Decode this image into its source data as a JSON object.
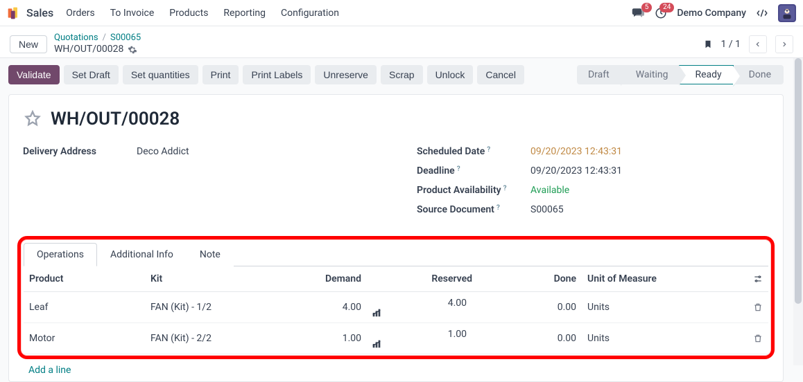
{
  "nav": {
    "app": "Sales",
    "items": [
      "Orders",
      "To Invoice",
      "Products",
      "Reporting",
      "Configuration"
    ],
    "chat_badge": "5",
    "activity_badge": "24",
    "company": "Demo Company"
  },
  "breadcrumb": {
    "new_label": "New",
    "quotations": "Quotations",
    "order": "S00065",
    "record": "WH/OUT/00028",
    "pager": "1 / 1"
  },
  "toolbar": {
    "validate": "Validate",
    "set_draft": "Set Draft",
    "set_quantities": "Set quantities",
    "print": "Print",
    "print_labels": "Print Labels",
    "unreserve": "Unreserve",
    "scrap": "Scrap",
    "unlock": "Unlock",
    "cancel": "Cancel"
  },
  "status": {
    "draft": "Draft",
    "waiting": "Waiting",
    "ready": "Ready",
    "done": "Done"
  },
  "record": {
    "title": "WH/OUT/00028",
    "delivery_address_label": "Delivery Address",
    "delivery_address": "Deco Addict",
    "scheduled_date_label": "Scheduled Date",
    "scheduled_date": "09/20/2023 12:43:31",
    "deadline_label": "Deadline",
    "deadline": "09/20/2023 12:43:31",
    "availability_label": "Product Availability",
    "availability": "Available",
    "source_label": "Source Document",
    "source": "S00065"
  },
  "tabs": {
    "operations": "Operations",
    "additional": "Additional Info",
    "note": "Note"
  },
  "columns": {
    "product": "Product",
    "kit": "Kit",
    "demand": "Demand",
    "reserved": "Reserved",
    "done": "Done",
    "uom": "Unit of Measure"
  },
  "lines": [
    {
      "product": "Leaf",
      "kit": "FAN (Kit) - 1/2",
      "demand": "4.00",
      "reserved": "4.00",
      "done": "0.00",
      "uom": "Units"
    },
    {
      "product": "Motor",
      "kit": "FAN (Kit) - 2/2",
      "demand": "1.00",
      "reserved": "1.00",
      "done": "0.00",
      "uom": "Units"
    }
  ],
  "add_line": "Add a line"
}
